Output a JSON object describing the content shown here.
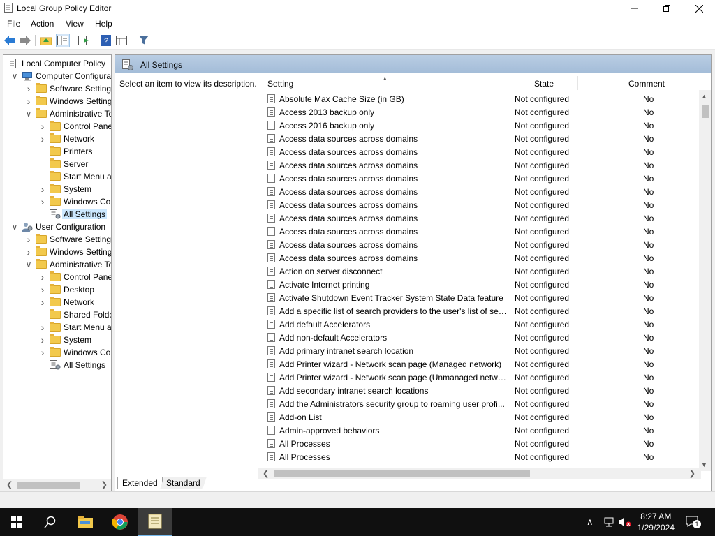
{
  "window": {
    "title": "Local Group Policy Editor"
  },
  "menu": [
    "File",
    "Action",
    "View",
    "Help"
  ],
  "tree": {
    "items": [
      {
        "label": "Local Computer Policy",
        "level": 0,
        "arrow": "",
        "icon": "computer-policy-icon"
      },
      {
        "label": "Computer Configuration",
        "level": 1,
        "arrow": "expanded",
        "icon": "computer-icon"
      },
      {
        "label": "Software Settings",
        "level": 2,
        "arrow": "collapsed",
        "icon": "folder-icon"
      },
      {
        "label": "Windows Settings",
        "level": 2,
        "arrow": "collapsed",
        "icon": "folder-icon"
      },
      {
        "label": "Administrative Templates",
        "level": 2,
        "arrow": "expanded",
        "icon": "folder-icon"
      },
      {
        "label": "Control Panel",
        "level": 3,
        "arrow": "collapsed",
        "icon": "folder-icon"
      },
      {
        "label": "Network",
        "level": 3,
        "arrow": "collapsed",
        "icon": "folder-icon"
      },
      {
        "label": "Printers",
        "level": 3,
        "arrow": "",
        "icon": "folder-icon"
      },
      {
        "label": "Server",
        "level": 3,
        "arrow": "",
        "icon": "folder-icon"
      },
      {
        "label": "Start Menu and Taskbar",
        "level": 3,
        "arrow": "",
        "icon": "folder-icon"
      },
      {
        "label": "System",
        "level": 3,
        "arrow": "collapsed",
        "icon": "folder-icon"
      },
      {
        "label": "Windows Components",
        "level": 3,
        "arrow": "collapsed",
        "icon": "folder-icon"
      },
      {
        "label": "All Settings",
        "level": 3,
        "arrow": "",
        "icon": "all-settings-icon",
        "selected": true
      },
      {
        "label": "User Configuration",
        "level": 1,
        "arrow": "expanded",
        "icon": "user-icon"
      },
      {
        "label": "Software Settings",
        "level": 2,
        "arrow": "collapsed",
        "icon": "folder-icon"
      },
      {
        "label": "Windows Settings",
        "level": 2,
        "arrow": "collapsed",
        "icon": "folder-icon"
      },
      {
        "label": "Administrative Templates",
        "level": 2,
        "arrow": "expanded",
        "icon": "folder-icon"
      },
      {
        "label": "Control Panel",
        "level": 3,
        "arrow": "collapsed",
        "icon": "folder-icon"
      },
      {
        "label": "Desktop",
        "level": 3,
        "arrow": "collapsed",
        "icon": "folder-icon"
      },
      {
        "label": "Network",
        "level": 3,
        "arrow": "collapsed",
        "icon": "folder-icon"
      },
      {
        "label": "Shared Folders",
        "level": 3,
        "arrow": "",
        "icon": "folder-icon"
      },
      {
        "label": "Start Menu and Taskbar",
        "level": 3,
        "arrow": "collapsed",
        "icon": "folder-icon"
      },
      {
        "label": "System",
        "level": 3,
        "arrow": "collapsed",
        "icon": "folder-icon"
      },
      {
        "label": "Windows Components",
        "level": 3,
        "arrow": "collapsed",
        "icon": "folder-icon"
      },
      {
        "label": "All Settings",
        "level": 3,
        "arrow": "",
        "icon": "all-settings-icon"
      }
    ]
  },
  "right_pane": {
    "header_title": "All Settings",
    "description": "Select an item to view its description.",
    "columns": {
      "setting": "Setting",
      "state": "State",
      "comment": "Comment"
    },
    "rows": [
      {
        "setting": "Absolute Max Cache Size (in GB)",
        "state": "Not configured",
        "comment": "No"
      },
      {
        "setting": "Access 2013 backup only",
        "state": "Not configured",
        "comment": "No"
      },
      {
        "setting": "Access 2016 backup only",
        "state": "Not configured",
        "comment": "No"
      },
      {
        "setting": "Access data sources across domains",
        "state": "Not configured",
        "comment": "No"
      },
      {
        "setting": "Access data sources across domains",
        "state": "Not configured",
        "comment": "No"
      },
      {
        "setting": "Access data sources across domains",
        "state": "Not configured",
        "comment": "No"
      },
      {
        "setting": "Access data sources across domains",
        "state": "Not configured",
        "comment": "No"
      },
      {
        "setting": "Access data sources across domains",
        "state": "Not configured",
        "comment": "No"
      },
      {
        "setting": "Access data sources across domains",
        "state": "Not configured",
        "comment": "No"
      },
      {
        "setting": "Access data sources across domains",
        "state": "Not configured",
        "comment": "No"
      },
      {
        "setting": "Access data sources across domains",
        "state": "Not configured",
        "comment": "No"
      },
      {
        "setting": "Access data sources across domains",
        "state": "Not configured",
        "comment": "No"
      },
      {
        "setting": "Access data sources across domains",
        "state": "Not configured",
        "comment": "No"
      },
      {
        "setting": "Action on server disconnect",
        "state": "Not configured",
        "comment": "No"
      },
      {
        "setting": "Activate Internet printing",
        "state": "Not configured",
        "comment": "No"
      },
      {
        "setting": "Activate Shutdown Event Tracker System State Data feature",
        "state": "Not configured",
        "comment": "No"
      },
      {
        "setting": "Add a specific list of search providers to the user's list of sea...",
        "state": "Not configured",
        "comment": "No"
      },
      {
        "setting": "Add default Accelerators",
        "state": "Not configured",
        "comment": "No"
      },
      {
        "setting": "Add non-default Accelerators",
        "state": "Not configured",
        "comment": "No"
      },
      {
        "setting": "Add primary intranet search location",
        "state": "Not configured",
        "comment": "No"
      },
      {
        "setting": "Add Printer wizard - Network scan page (Managed network)",
        "state": "Not configured",
        "comment": "No"
      },
      {
        "setting": "Add Printer wizard - Network scan page (Unmanaged netwo...",
        "state": "Not configured",
        "comment": "No"
      },
      {
        "setting": "Add secondary intranet search locations",
        "state": "Not configured",
        "comment": "No"
      },
      {
        "setting": "Add the Administrators security group to roaming user profi...",
        "state": "Not configured",
        "comment": "No"
      },
      {
        "setting": "Add-on List",
        "state": "Not configured",
        "comment": "No"
      },
      {
        "setting": "Admin-approved behaviors",
        "state": "Not configured",
        "comment": "No"
      },
      {
        "setting": "All Processes",
        "state": "Not configured",
        "comment": "No"
      },
      {
        "setting": "All Processes",
        "state": "Not configured",
        "comment": "No"
      }
    ]
  },
  "tabs": {
    "extended": "Extended",
    "standard": "Standard"
  },
  "taskbar": {
    "time": "8:27 AM",
    "date": "1/29/2024",
    "notification_count": "1"
  }
}
